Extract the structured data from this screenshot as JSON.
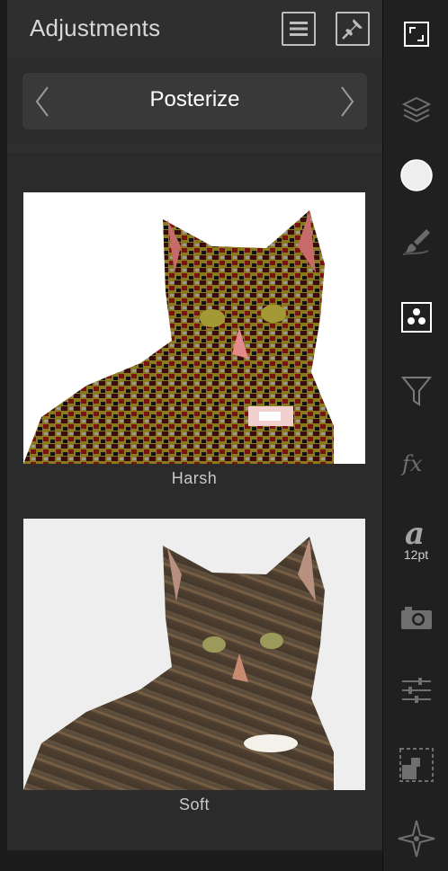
{
  "panel": {
    "title": "Adjustments",
    "selected_adjustment": "Posterize"
  },
  "presets": [
    {
      "caption": "Harsh"
    },
    {
      "caption": "Soft"
    }
  ],
  "toolbar": {
    "font_size_label": "12pt",
    "tools": [
      "resize-icon",
      "layers-icon",
      "color-circle-icon",
      "brush-icon",
      "adjustments-icon",
      "filter-icon",
      "fx-icon",
      "text-icon",
      "camera-icon",
      "sliders-icon",
      "selection-icon",
      "navigator-icon"
    ]
  },
  "colors": {
    "panel_bg": "#2b2b2b",
    "header_bg": "#2f2f2f",
    "toolbar_bg": "#202020",
    "accent_icon": "#ffffff",
    "dim_icon": "#7a7a7a"
  }
}
